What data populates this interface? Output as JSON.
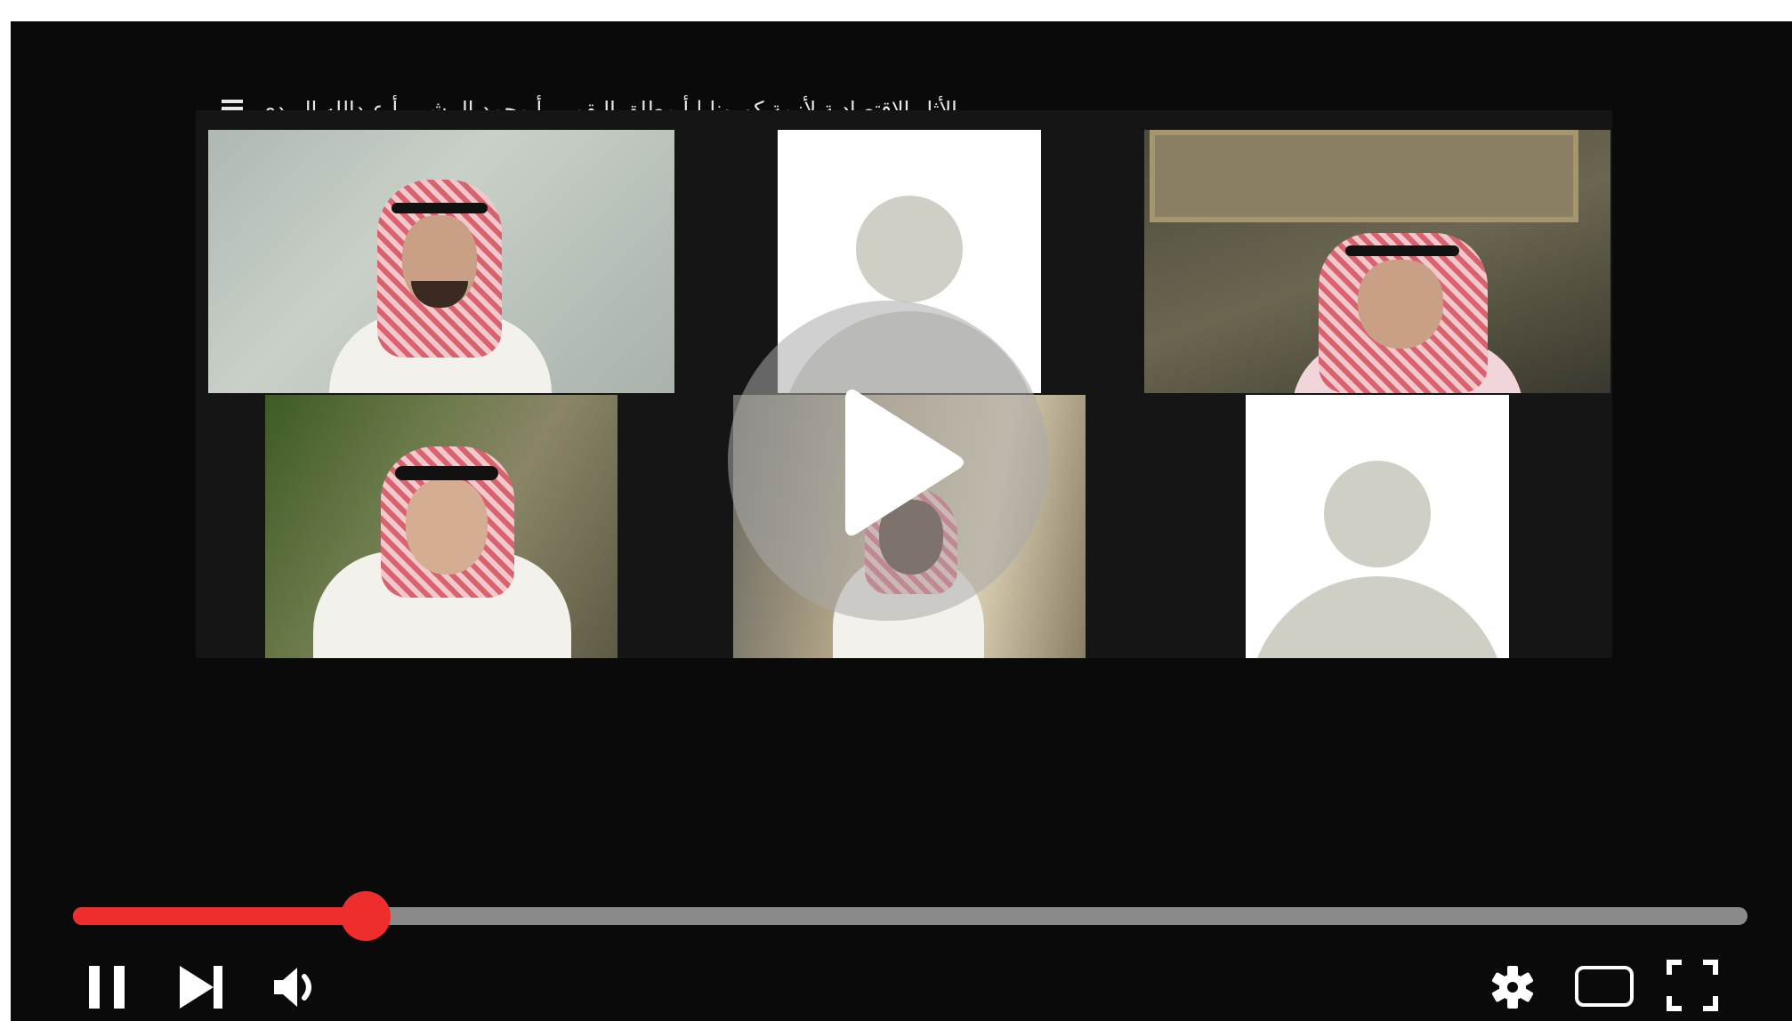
{
  "video": {
    "title": "الأثار الاقتصادية لأزمة كورونا | أ مطلق البقمي، أ محمد البيشي، أ عبدالله الربدي"
  },
  "player": {
    "progress_fraction": 0.175,
    "accent_color": "#ef2d2d",
    "track_color": "#8a8a8a"
  },
  "controls": {
    "left": [
      "pause-icon",
      "next-icon",
      "volume-icon"
    ],
    "right": [
      "settings-icon",
      "theater-mode-icon",
      "fullscreen-icon"
    ]
  }
}
